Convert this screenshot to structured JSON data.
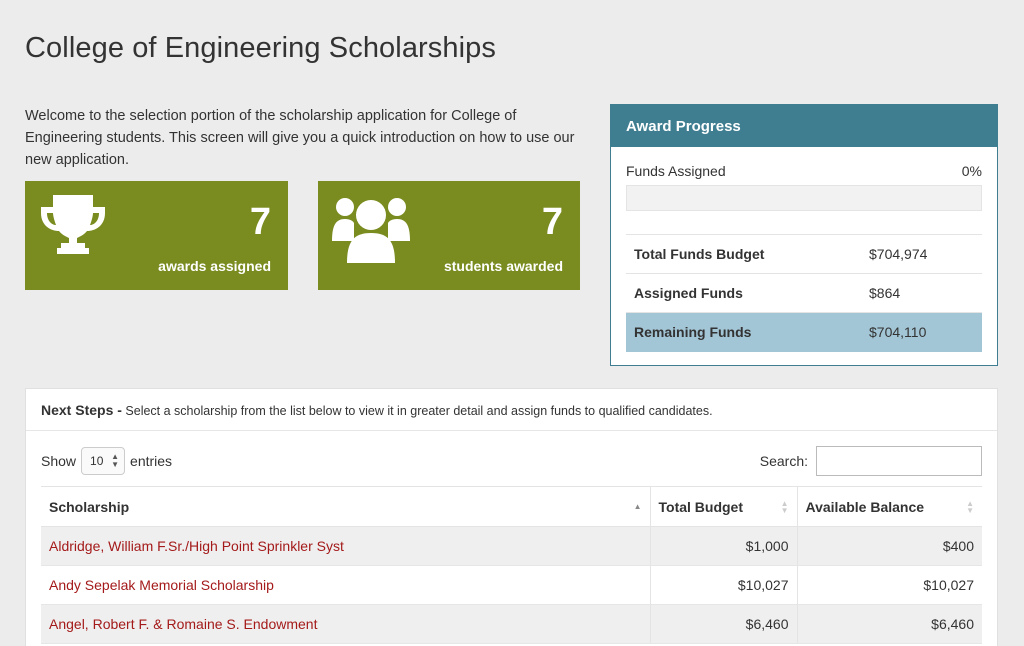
{
  "page": {
    "title": "College of Engineering Scholarships",
    "intro": "Welcome to the selection portion of the scholarship application for College of Engineering students. This screen will give you a quick introduction on how to use our new application."
  },
  "stats": {
    "awards": {
      "number": "7",
      "label": "awards assigned",
      "icon": "trophy-icon"
    },
    "students": {
      "number": "7",
      "label": "students awarded",
      "icon": "users-group-icon"
    }
  },
  "award_progress": {
    "title": "Award Progress",
    "funds_label": "Funds Assigned",
    "funds_percent_text": "0%",
    "funds_fraction": 0.0,
    "rows": [
      {
        "label": "Total Funds Budget",
        "value": "$704,974"
      },
      {
        "label": "Assigned Funds",
        "value": "$864"
      },
      {
        "label": "Remaining Funds",
        "value": "$704,110"
      }
    ]
  },
  "next_steps": {
    "title": "Next Steps -",
    "description": "Select a scholarship from the list below to view it in greater detail and assign funds to qualified candidates.",
    "show_label": "Show",
    "entries_label": "entries",
    "page_length": "10",
    "search_label": "Search:",
    "search_value": "",
    "columns": [
      "Scholarship",
      "Total Budget",
      "Available Balance"
    ],
    "rows": [
      {
        "name": "Aldridge, William F.Sr./High Point Sprinkler Syst",
        "budget": "$1,000",
        "balance": "$400"
      },
      {
        "name": "Andy Sepelak Memorial Scholarship",
        "budget": "$10,027",
        "balance": "$10,027"
      },
      {
        "name": "Angel, Robert F. & Romaine S. Endowment",
        "budget": "$6,460",
        "balance": "$6,460"
      }
    ]
  },
  "colors": {
    "stat_green": "#7a8b1f",
    "panel_blue": "#3f7d91",
    "remaining_row": "#a3c6d6",
    "link_red": "#a41a1a"
  }
}
